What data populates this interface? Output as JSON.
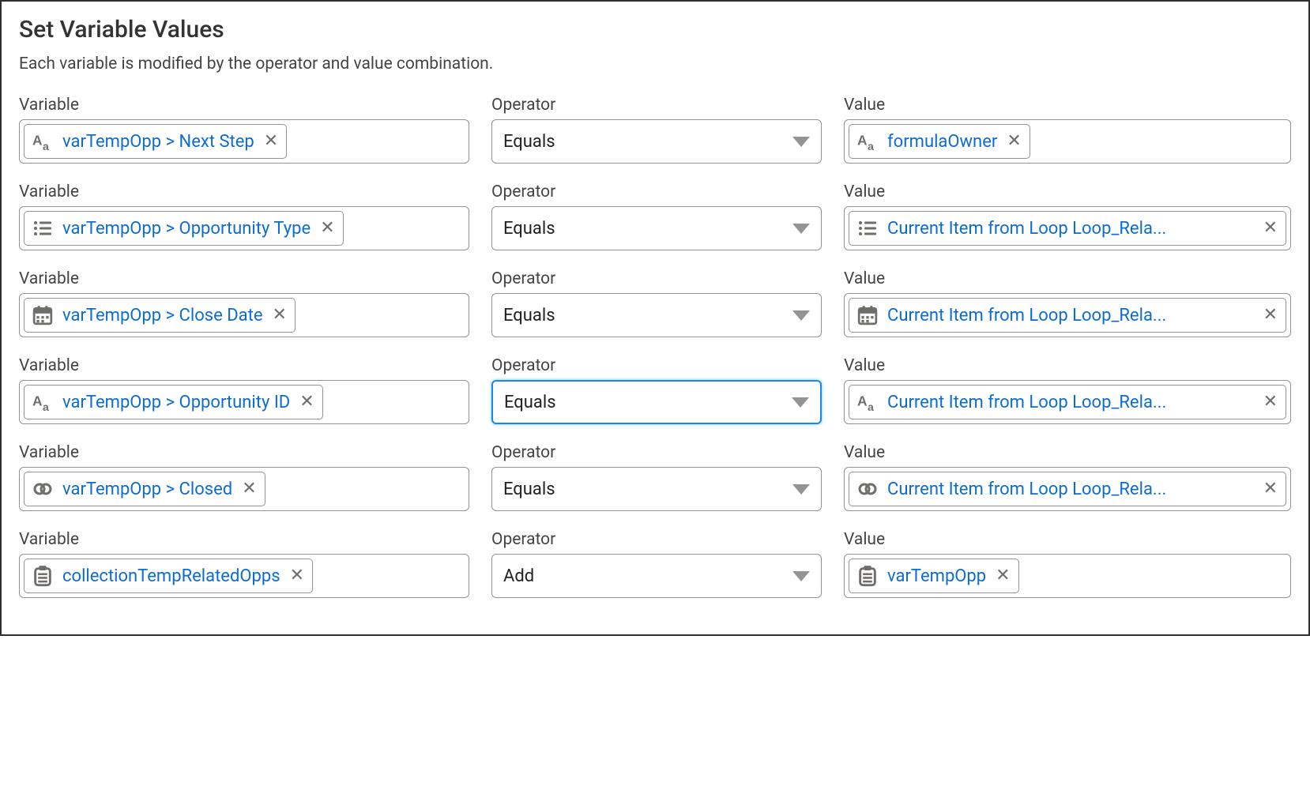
{
  "title": "Set Variable Values",
  "subtitle": "Each variable is modified by the operator and value combination.",
  "labels": {
    "variable": "Variable",
    "operator": "Operator",
    "value": "Value"
  },
  "rows": [
    {
      "variable": {
        "icon": "text",
        "text": "varTempOpp > Next Step"
      },
      "operator": {
        "text": "Equals",
        "focused": false
      },
      "value": {
        "icon": "text",
        "text": "formulaOwner"
      }
    },
    {
      "variable": {
        "icon": "picklist",
        "text": "varTempOpp > Opportunity Type"
      },
      "operator": {
        "text": "Equals",
        "focused": false
      },
      "value": {
        "icon": "picklist",
        "text": "Current Item from Loop Loop_Rela..."
      }
    },
    {
      "variable": {
        "icon": "date",
        "text": "varTempOpp > Close Date"
      },
      "operator": {
        "text": "Equals",
        "focused": false
      },
      "value": {
        "icon": "date",
        "text": "Current Item from Loop Loop_Rela..."
      }
    },
    {
      "variable": {
        "icon": "text",
        "text": "varTempOpp > Opportunity ID"
      },
      "operator": {
        "text": "Equals",
        "focused": true
      },
      "value": {
        "icon": "text",
        "text": "Current Item from Loop Loop_Rela..."
      }
    },
    {
      "variable": {
        "icon": "link",
        "text": "varTempOpp > Closed"
      },
      "operator": {
        "text": "Equals",
        "focused": false
      },
      "value": {
        "icon": "link",
        "text": "Current Item from Loop Loop_Rela..."
      }
    },
    {
      "variable": {
        "icon": "record",
        "text": "collectionTempRelatedOpps"
      },
      "operator": {
        "text": "Add",
        "focused": false
      },
      "value": {
        "icon": "record",
        "text": "varTempOpp"
      }
    }
  ]
}
